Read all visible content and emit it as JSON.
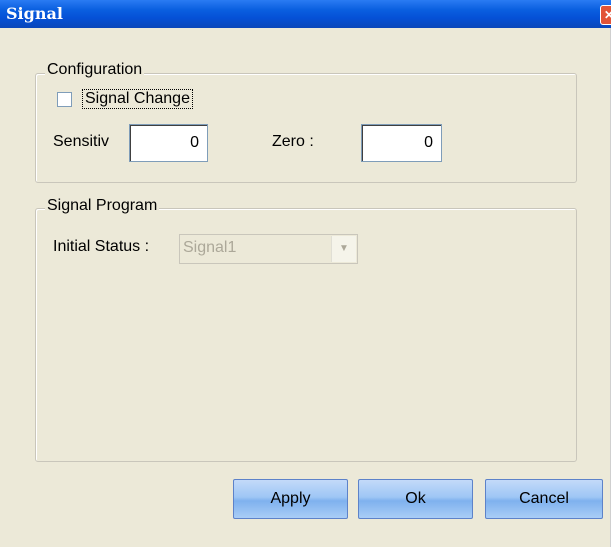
{
  "window": {
    "title": "Signal",
    "close_icon": "close-icon"
  },
  "configuration": {
    "legend": "Configuration",
    "signal_change": {
      "label": "Signal Change",
      "checked": false
    },
    "sensitivity": {
      "label": "Sensitiv",
      "value": "0"
    },
    "zero": {
      "label": "Zero :",
      "value": "0"
    }
  },
  "program": {
    "legend": "Signal Program",
    "initial_status": {
      "label": "Initial Status :",
      "value": "Signal1"
    }
  },
  "buttons": {
    "apply": "Apply",
    "ok": "Ok",
    "cancel": "Cancel"
  },
  "colors": {
    "titlebar": "#0550d6",
    "button": "#9ec6f5",
    "background": "#ece9d8"
  }
}
